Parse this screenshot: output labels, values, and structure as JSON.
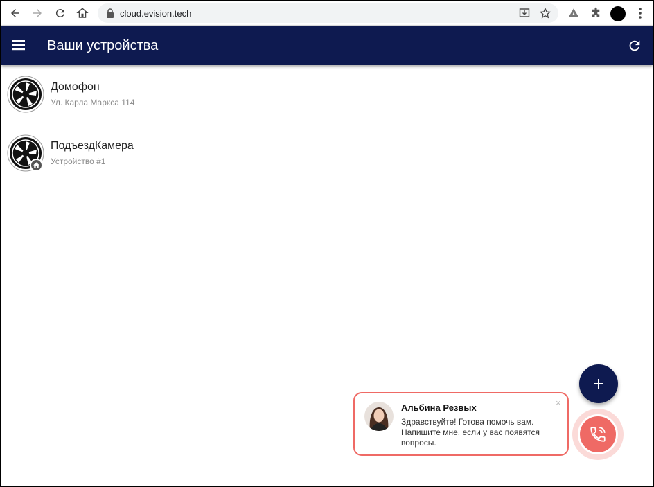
{
  "browser": {
    "url": "cloud.evision.tech"
  },
  "appbar": {
    "title": "Ваши устройства"
  },
  "devices": [
    {
      "name": "Домофон",
      "subtitle": "Ул. Карла Маркса 114",
      "shared": false
    },
    {
      "name": "ПодъездКамера",
      "subtitle": "Устройство #1",
      "shared": true
    }
  ],
  "chat": {
    "agent_name": "Альбина Резвых",
    "message": "Здравствуйте! Готова помочь вам. Напишите мне, если у вас появятся вопросы.",
    "close_label": "×"
  },
  "fab": {
    "label": "+"
  },
  "colors": {
    "appbar": "#0e1a50",
    "accent_call": "#ef6a65"
  }
}
